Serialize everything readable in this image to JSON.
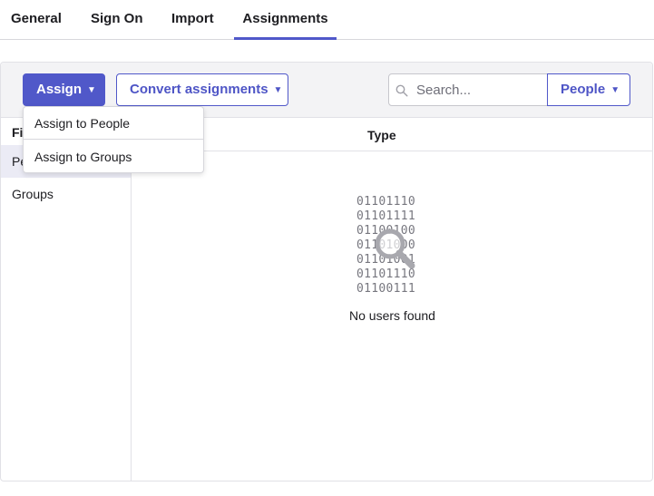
{
  "tabs": [
    {
      "label": "General"
    },
    {
      "label": "Sign On"
    },
    {
      "label": "Import"
    },
    {
      "label": "Assignments"
    }
  ],
  "toolbar": {
    "assign_label": "Assign",
    "convert_label": "Convert assignments",
    "search_placeholder": "Search...",
    "people_label": "People",
    "accent_color": "#5058c9"
  },
  "dropdown": {
    "items": [
      {
        "label": "Assign to People"
      },
      {
        "label": "Assign to Groups"
      }
    ]
  },
  "filters": {
    "title": "Filters",
    "items": [
      {
        "label": "People"
      },
      {
        "label": "Groups"
      }
    ]
  },
  "table": {
    "type_header": "Type"
  },
  "empty_state": {
    "binary_lines": [
      "01101110",
      "01101111",
      "01100100",
      "01101000",
      "01101001",
      "01101110",
      "01100111"
    ],
    "message": "No users found"
  },
  "icons": {
    "search": "search-icon",
    "magnifier": "magnifier-icon",
    "caret": "caret-down-icon"
  }
}
